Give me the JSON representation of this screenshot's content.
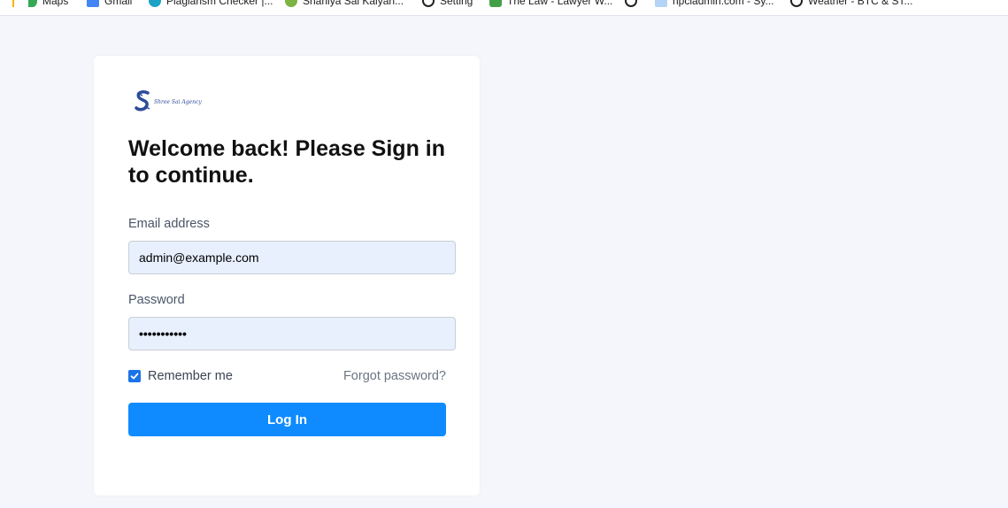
{
  "bookmarks": [
    {
      "label": "Maps",
      "icon": "maps-pin-icon"
    },
    {
      "label": "Gmail",
      "icon": "gmail-icon"
    },
    {
      "label": "Plagiarism Checker |...",
      "icon": "plagiarism-checker-icon"
    },
    {
      "label": "Shaniya Sai Kalyan...",
      "icon": "site-favicon-icon"
    },
    {
      "label": "Setting",
      "icon": "site-favicon-icon"
    },
    {
      "label": "The Law - Lawyer W...",
      "icon": "site-favicon-icon"
    },
    {
      "label": "",
      "icon": "site-favicon-icon"
    },
    {
      "label": "npciadmin.com - Sy...",
      "icon": "site-favicon-icon"
    },
    {
      "label": "Weather - BTC & ST...",
      "icon": "site-favicon-icon"
    }
  ],
  "brand": {
    "logo_text": "Shree Sai Agency",
    "logo_color": "#2c4b9a"
  },
  "login": {
    "heading": "Welcome back! Please Sign in to continue.",
    "email_label": "Email address",
    "email_value": "admin@example.com",
    "password_label": "Password",
    "password_value": "•••••••••••",
    "remember_label": "Remember me",
    "remember_checked": true,
    "forgot_label": "Forgot password?",
    "submit_label": "Log In"
  },
  "colors": {
    "page_background": "#f4f6fb",
    "primary_button": "#0f8bff",
    "input_fill": "#e8f0fe",
    "checkbox": "#1a73e8"
  }
}
